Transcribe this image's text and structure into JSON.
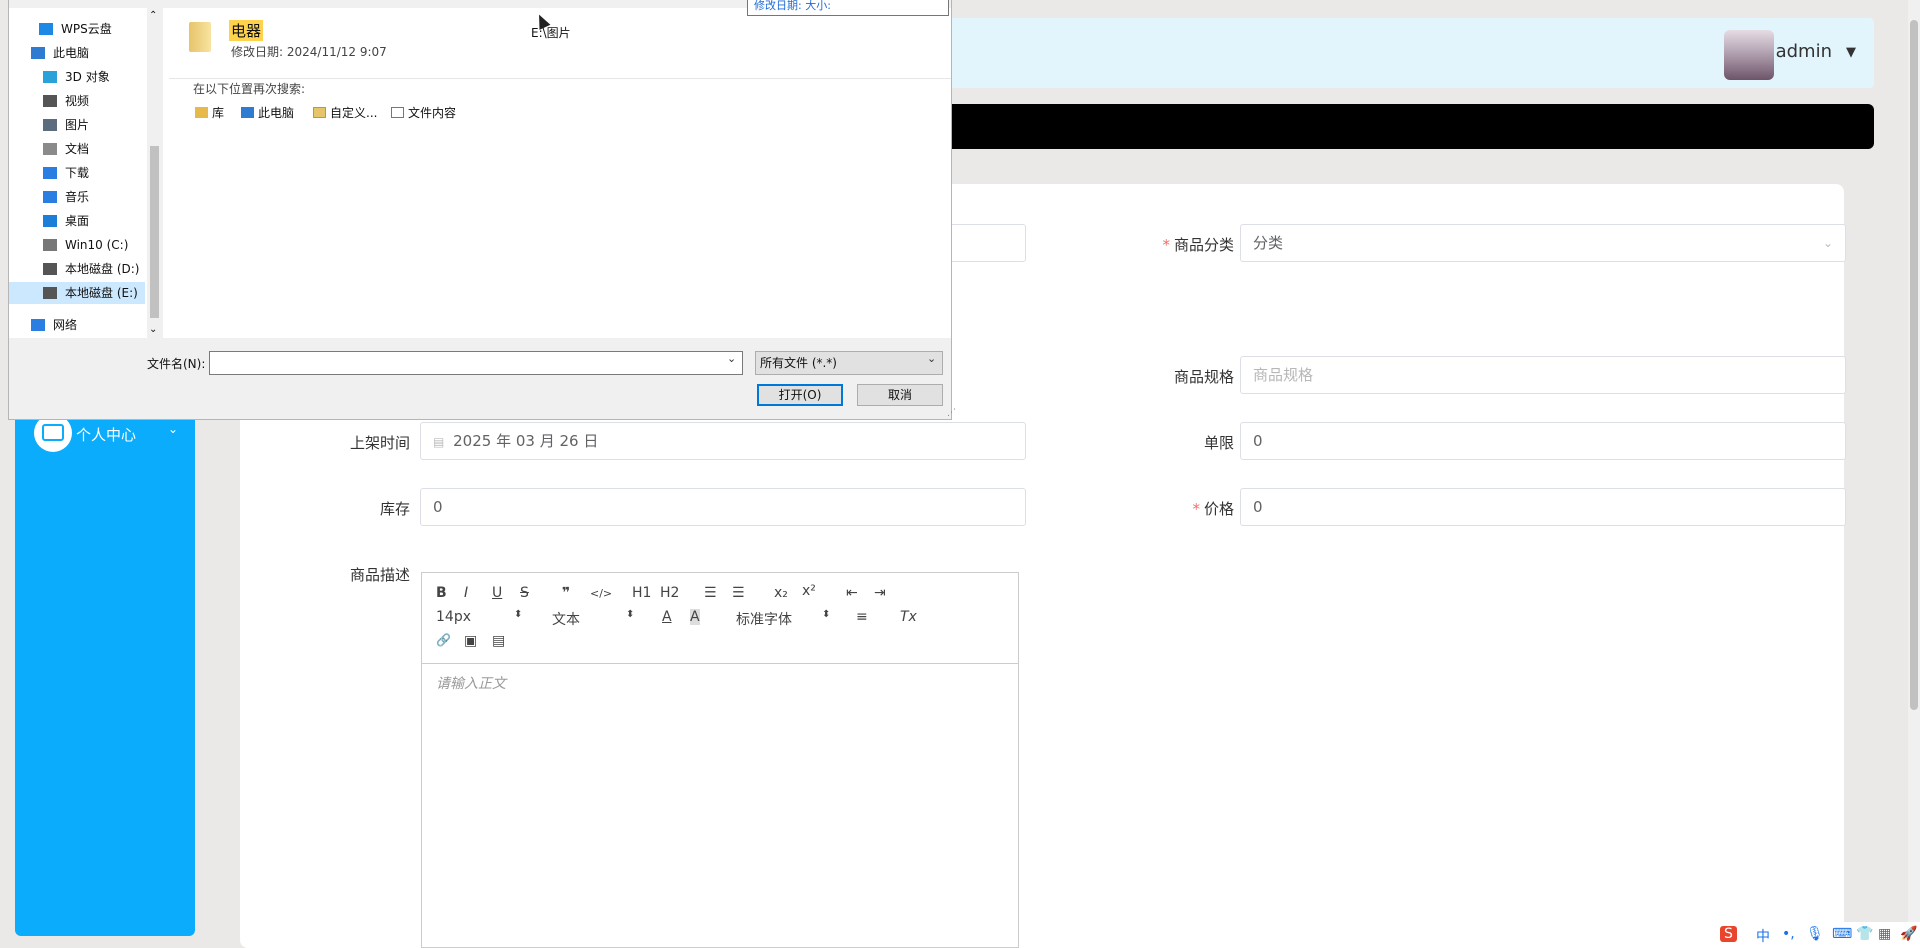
{
  "header": {
    "user_name": "admin",
    "caret": "▼"
  },
  "sidebar": {
    "menu_label": "个人中心",
    "chevron": "⌄"
  },
  "form": {
    "category_label": "商品分类",
    "category_value": "分类",
    "spec_label": "商品规格",
    "spec_placeholder": "商品规格",
    "shelf_time_label": "上架时间",
    "shelf_time_value": "2025 年 03 月 26 日",
    "limit_label": "单限",
    "limit_value": "0",
    "stock_label": "库存",
    "stock_value": "0",
    "price_label": "价格",
    "price_value": "0",
    "desc_label": "商品描述",
    "required_mark": "*"
  },
  "editor": {
    "toolbar": {
      "bold": "B",
      "italic": "I",
      "underline": "U",
      "strike": "S",
      "quote": "❞",
      "code": "</>",
      "h1": "H1",
      "h2": "H2",
      "ol": "☰",
      "ul": "☰",
      "sub": "x₂",
      "sup": "x²",
      "outdent": "⇤",
      "indent": "⇥",
      "size": "14px",
      "format": "文本",
      "color": "A",
      "bg": "A",
      "font": "标准字体",
      "align": "≡",
      "clean": "Tx",
      "link": "🔗",
      "image": "▣",
      "video": "▤"
    },
    "placeholder": "请输入正文"
  },
  "dialog": {
    "nav_items": [
      {
        "label": "WPS云盘",
        "icon": "cloud-icon",
        "color": "#1e88e5"
      },
      {
        "label": "此电脑",
        "icon": "computer-icon",
        "color": "#2f7bd1"
      },
      {
        "label": "3D 对象",
        "icon": "cube-icon",
        "color": "#2aa1d9"
      },
      {
        "label": "视频",
        "icon": "video-icon",
        "color": "#555555"
      },
      {
        "label": "图片",
        "icon": "picture-icon",
        "color": "#5a6c7d"
      },
      {
        "label": "文档",
        "icon": "document-icon",
        "color": "#8a8a8a"
      },
      {
        "label": "下载",
        "icon": "download-icon",
        "color": "#2a7de1"
      },
      {
        "label": "音乐",
        "icon": "music-icon",
        "color": "#2a7de1"
      },
      {
        "label": "桌面",
        "icon": "desktop-icon",
        "color": "#1c7ed6"
      },
      {
        "label": "Win10 (C:)",
        "icon": "drive-icon",
        "color": "#777777"
      },
      {
        "label": "本地磁盘 (D:)",
        "icon": "drive-icon",
        "color": "#555555"
      },
      {
        "label": "本地磁盘 (E:)",
        "icon": "drive-icon",
        "color": "#555555"
      },
      {
        "label": "网络",
        "icon": "network-icon",
        "color": "#2a7de1"
      }
    ],
    "folder": {
      "name": "电器",
      "date": "修改日期: 2024/11/12 9:07",
      "path": "E:\\图片"
    },
    "search_again": "在以下位置再次搜索:",
    "search_locations": [
      "库",
      "此电脑",
      "自定义...",
      "文件内容"
    ],
    "filename_label": "文件名(N):",
    "filetype": "所有文件 (*.*)",
    "open_btn": "打开(O)",
    "cancel_btn": "取消",
    "tooltip": "修改日期:    大小:",
    "caret": "⌄"
  },
  "tray": [
    "S",
    "中",
    "•,",
    "🎙",
    "⌨",
    "👕",
    "▦",
    "🚀"
  ],
  "colors": {
    "sidebar": "#0aacfb",
    "header": "#e2f4fc",
    "required": "#f56c6c"
  }
}
